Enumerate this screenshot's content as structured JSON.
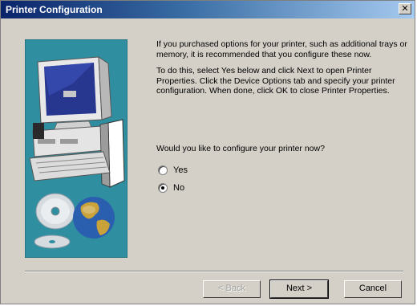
{
  "window": {
    "title": "Printer Configuration",
    "close_glyph": "✕",
    "close_icon": "close-icon"
  },
  "body": {
    "paragraph_1": "If you purchased options for your printer, such as additional trays or memory, it is recommended that you configure these now.",
    "paragraph_2": "To do this, select Yes below and click Next to open Printer Properties. Click the Device Options tab and specify your printer configuration. When done, click OK to close Printer Properties.",
    "question": "Would you like to configure your printer now?"
  },
  "options": [
    {
      "label": "Yes",
      "selected": false
    },
    {
      "label": "No",
      "selected": true
    }
  ],
  "buttons": {
    "back": "< Back",
    "next": "Next >",
    "cancel": "Cancel"
  },
  "illustration": {
    "icons": [
      "computer-monitor-icon",
      "computer-case-icon",
      "keyboard-icon",
      "cd-disc-icon",
      "globe-icon"
    ]
  },
  "colors": {
    "dialog_bg": "#d4d0c8",
    "illustration_bg": "#2f8fa0",
    "title_gradient_start": "#0a246a"
  }
}
